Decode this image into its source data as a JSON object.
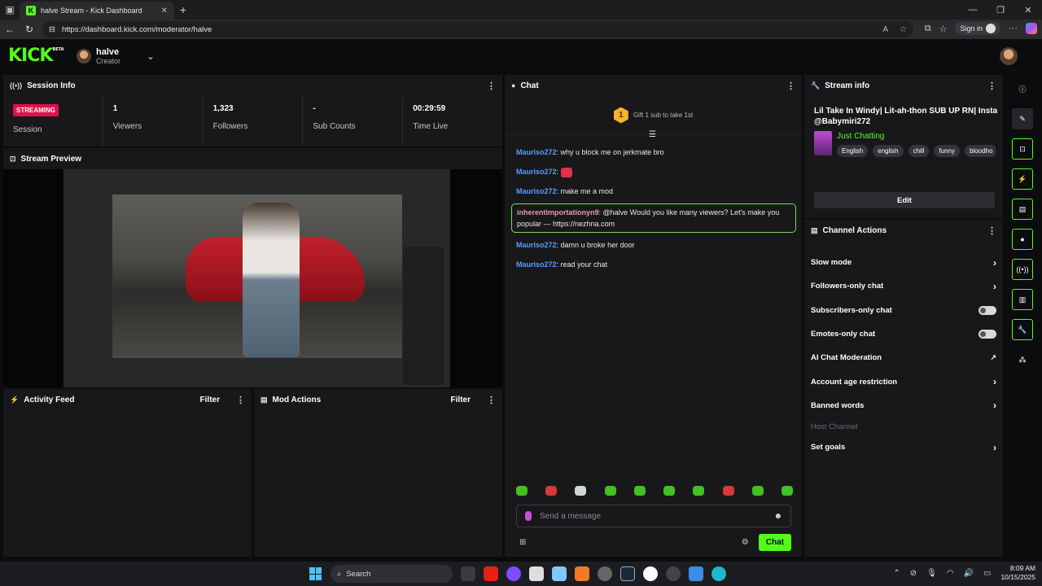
{
  "browser": {
    "tab_title": "halve Stream - Kick Dashboard",
    "url": "https://dashboard.kick.com/moderator/halve",
    "sign_in": "Sign in"
  },
  "header": {
    "logo": "KICK",
    "logo_badge": "BETA",
    "username": "halve",
    "role": "Creator"
  },
  "session_info": {
    "title": "Session Info",
    "stats": [
      {
        "value": "STREAMING",
        "label": "Session"
      },
      {
        "value": "1",
        "label": "Viewers"
      },
      {
        "value": "1,323",
        "label": "Followers"
      },
      {
        "value": "-",
        "label": "Sub Counts"
      },
      {
        "value": "00:29:59",
        "label": "Time Live"
      }
    ]
  },
  "stream_preview": {
    "title": "Stream Preview"
  },
  "activity_feed": {
    "title": "Activity Feed",
    "filter": "Filter"
  },
  "mod_actions": {
    "title": "Mod Actions",
    "filter": "Filter"
  },
  "chat": {
    "title": "Chat",
    "gift_rank": "1",
    "gift_text": "Gift 1 sub to take 1st",
    "messages": [
      {
        "user": "Mauriso272",
        "text": ": why u block me on jerkmate bro"
      },
      {
        "user": "Mauriso272",
        "text": ": "
      },
      {
        "user": "Mauriso272",
        "text": ": make me a mod"
      },
      {
        "user": "inherentimportationyn9",
        "text": ": @halve Would you like many viewers? Let's make you popular — https://nezhna.com"
      },
      {
        "user": "Mauriso272",
        "text": ": damn u broke her door"
      },
      {
        "user": "Mauriso272",
        "text": ": read your chat"
      }
    ],
    "input_placeholder": "Send a message",
    "send_label": "Chat"
  },
  "stream_info": {
    "title": "Stream info",
    "stream_title": "Lil Take In Windy| Lit-ah-thon SUB UP RN| Insta @Babymiri272",
    "category": "Just Chatting",
    "tags": [
      "English",
      "english",
      "chill",
      "funny",
      "bloodho"
    ],
    "edit_label": "Edit"
  },
  "channel_actions": {
    "title": "Channel Actions",
    "items": [
      {
        "label": "Slow mode"
      },
      {
        "label": "Followers-only chat"
      },
      {
        "label": "Subscribers-only chat"
      },
      {
        "label": "Emotes-only chat"
      },
      {
        "label": "AI Chat Moderation"
      },
      {
        "label": "Account age restriction"
      },
      {
        "label": "Banned words"
      },
      {
        "label": "Host Channel"
      },
      {
        "label": "Set goals"
      }
    ]
  },
  "taskbar": {
    "search": "Search",
    "time": "8:09 AM",
    "date": "10/15/2025"
  },
  "colors": {
    "brand": "#53fc18",
    "live": "#e0124b",
    "username": "#5c9bff"
  }
}
